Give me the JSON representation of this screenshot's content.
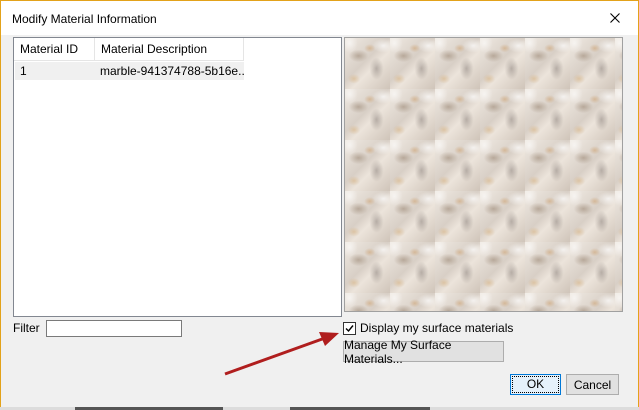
{
  "window": {
    "title": "Modify Material Information"
  },
  "icons": {
    "close": "close-icon",
    "check": "checkmark-icon",
    "arrow": "annotation-arrow"
  },
  "colors": {
    "window_border": "#e3a21a",
    "arrow": "#b01e1e",
    "ok_border": "#0078d7"
  },
  "material_list": {
    "columns": [
      "Material ID",
      "Material Description"
    ],
    "rows": [
      {
        "id": "1",
        "description": "marble-941374788-5b16e..."
      }
    ]
  },
  "filter": {
    "label": "Filter",
    "value": ""
  },
  "options": {
    "display_surface_label": "Display my surface materials",
    "display_surface_checked": true
  },
  "buttons": {
    "manage": "Manage My Surface Materials...",
    "ok": "OK",
    "cancel": "Cancel"
  }
}
